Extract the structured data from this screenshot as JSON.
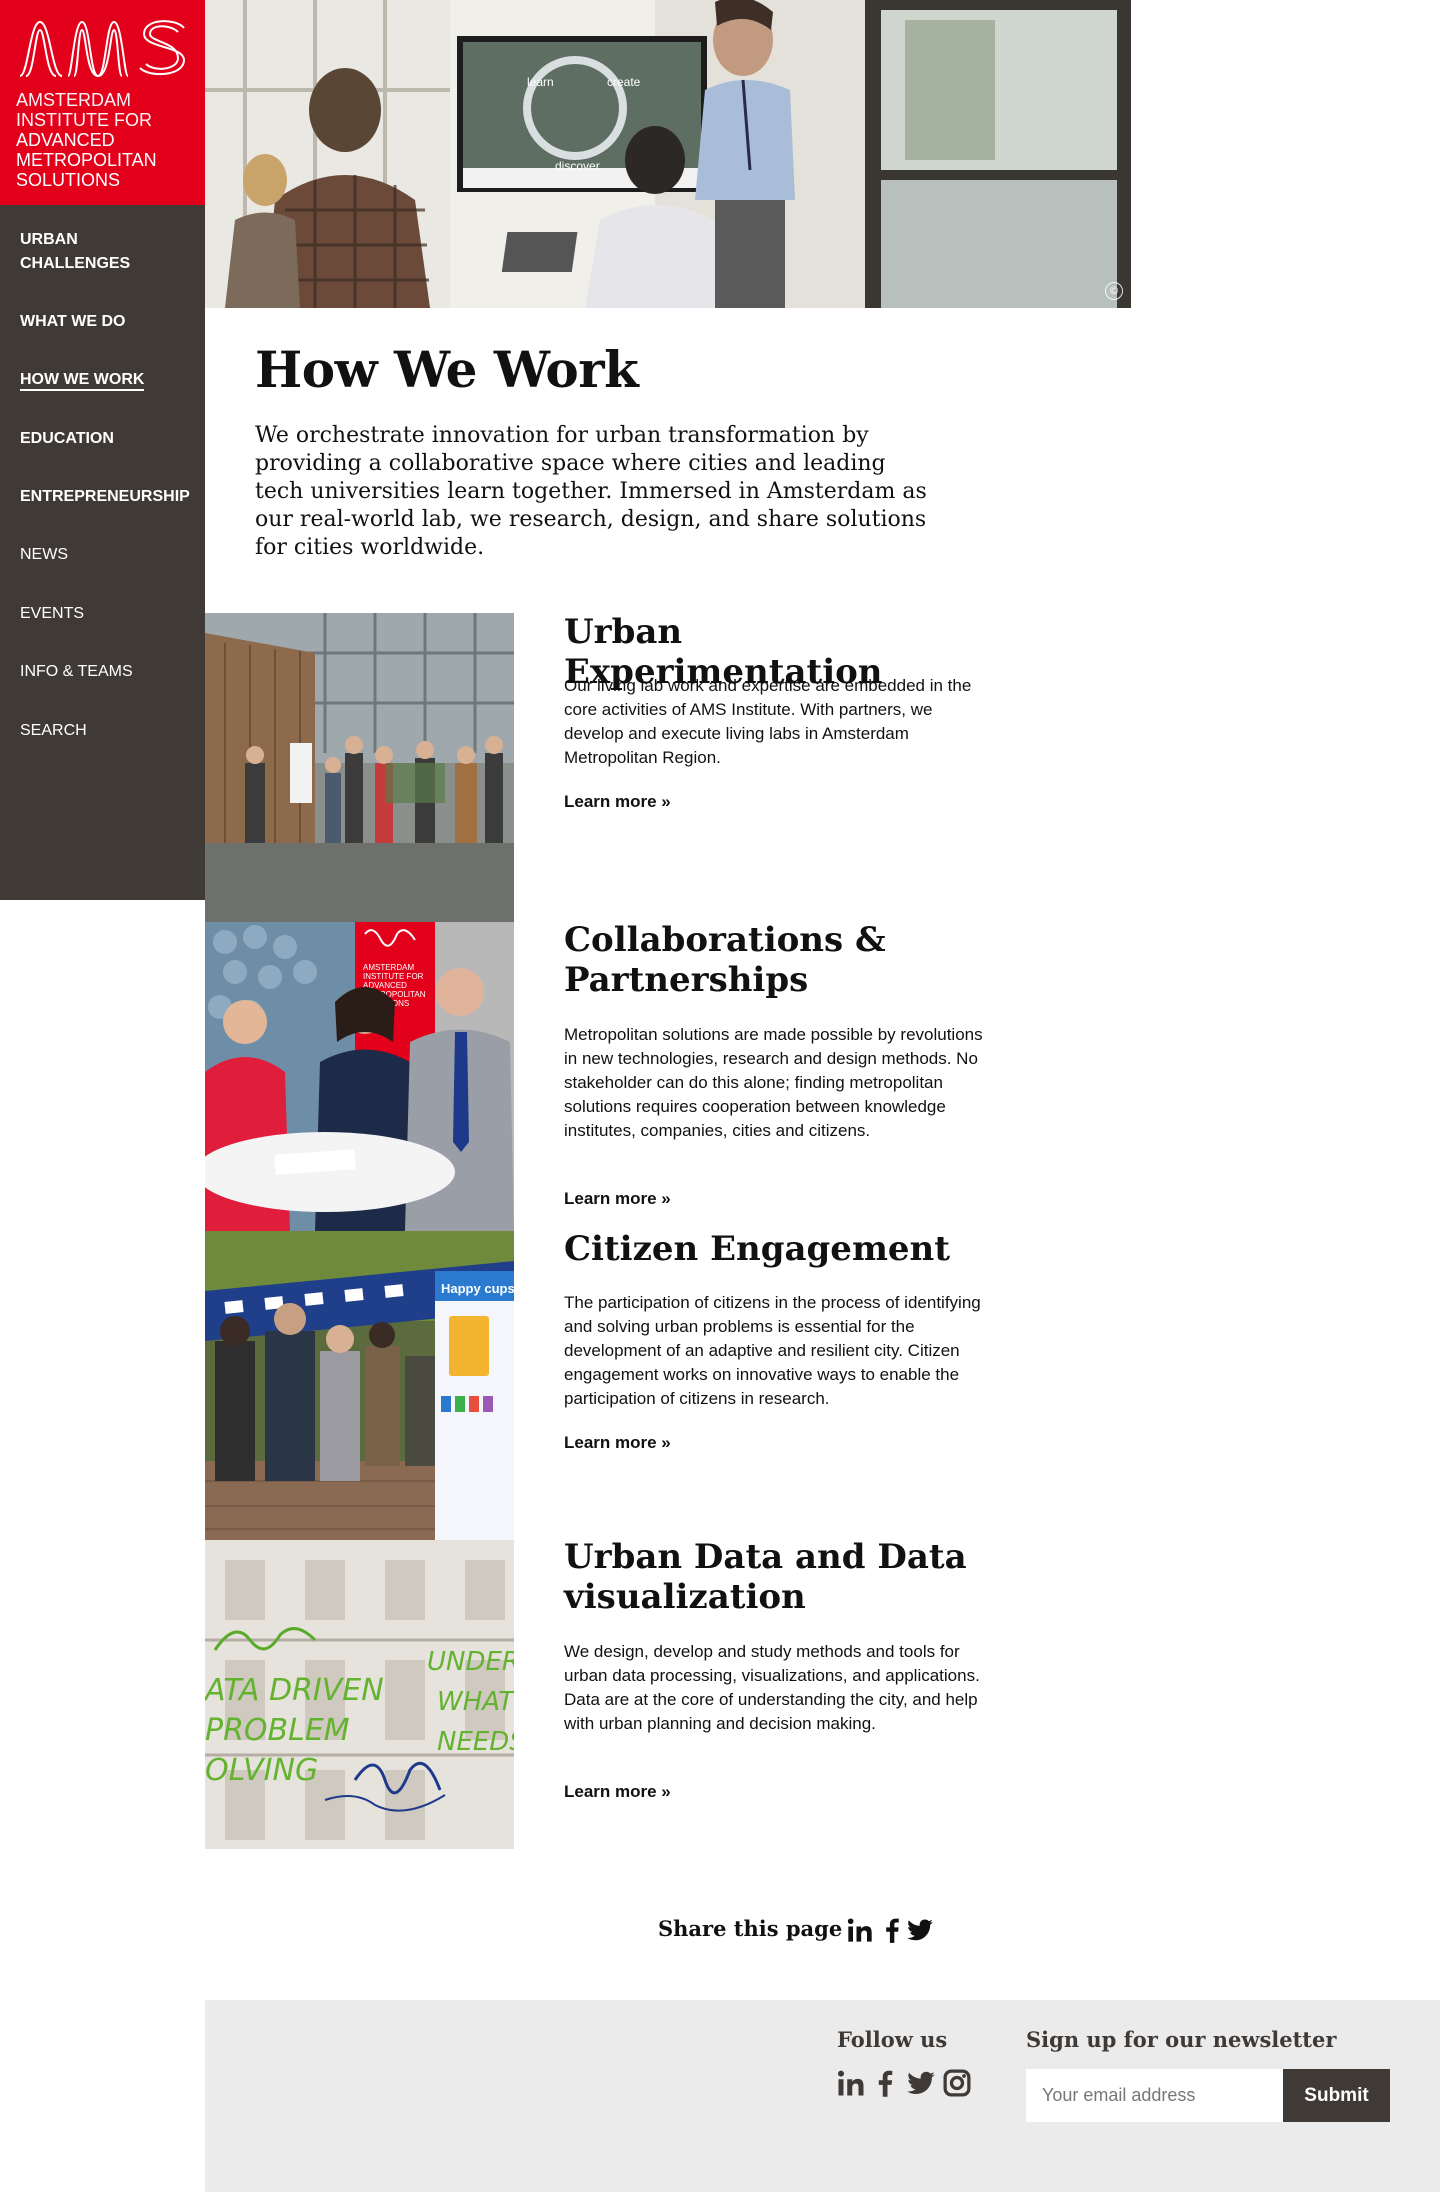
{
  "logo": {
    "mark": "AMS",
    "line1": "AMSTERDAM",
    "line2": "INSTITUTE FOR",
    "line3": "ADVANCED",
    "line4": "METROPOLITAN",
    "line5": "SOLUTIONS"
  },
  "nav": {
    "items": [
      {
        "label1": "URBAN",
        "label2": "CHALLENGES"
      },
      {
        "label": "WHAT WE DO"
      },
      {
        "label": "HOW WE WORK"
      },
      {
        "label": "EDUCATION"
      },
      {
        "label": "ENTREPRENEURSHIP"
      },
      {
        "label": "NEWS"
      },
      {
        "label": "EVENTS"
      },
      {
        "label": "INFO & TEAMS"
      },
      {
        "label": "SEARCH"
      }
    ],
    "active": "HOW WE WORK"
  },
  "hero": {
    "screen_words": [
      "learn",
      "create",
      "discover"
    ],
    "copyright_symbol": "©"
  },
  "page": {
    "title": "How We Work",
    "intro": "We orchestrate innovation for urban transformation by providing a collaborative space where cities and leading tech universities learn together. Immersed in Amsterdam as our real-world lab, we research, design, and share solutions for cities worldwide."
  },
  "sections": [
    {
      "title": "Urban Experimentation",
      "body": "Our living lab work and expertise are embedded in the core activities of AMS Institute. With partners, we develop and execute living labs in Amsterdam Metropolitan Region.",
      "link": "Learn more »"
    },
    {
      "title": "Collaborations & Partnerships",
      "body": "Metropolitan solutions are made possible by revolutions in new technologies, research and design methods. No stakeholder can do this alone; finding metropolitan solutions requires cooperation between knowledge institutes, companies, cities and citizens.",
      "link": "Learn more »",
      "image_logo_lines": [
        "AMSTERDAM",
        "INSTITUTE FOR",
        "ADVANCED",
        "METROPOLITAN",
        "SOLUTIONS"
      ]
    },
    {
      "title": "Citizen Engagement",
      "body": "The participation of citizens in the process of identifying and solving urban problems is essential for the development of an adaptive and resilient city. Citizen engagement works on innovative ways to enable the participation of citizens in research.",
      "link": "Learn more »",
      "image_banner": "Happy cups"
    },
    {
      "title": "Urban Data and Data visualization",
      "body": "We design, develop and study methods and tools for urban data processing, visualizations, and applications. Data are at the core of understanding the city, and help with urban planning and decision making.",
      "link": "Learn more »",
      "image_words": [
        "ATA DRIVEN",
        "PROBLEM",
        "OLVING",
        "UNDERS",
        "WHAT",
        "NEEDS"
      ]
    }
  ],
  "share": {
    "label": "Share this page",
    "icons": [
      "linkedin-icon",
      "facebook-icon",
      "twitter-icon"
    ]
  },
  "footer": {
    "follow_title": "Follow us",
    "follow_icons": [
      "linkedin-icon",
      "facebook-icon",
      "twitter-icon",
      "instagram-icon"
    ],
    "newsletter_title": "Sign up for our newsletter",
    "email_placeholder": "Your email address",
    "submit_label": "Submit"
  },
  "colors": {
    "brand_red": "#e2001a",
    "sidebar": "#403a37",
    "footer_bg": "#ebebeb"
  }
}
